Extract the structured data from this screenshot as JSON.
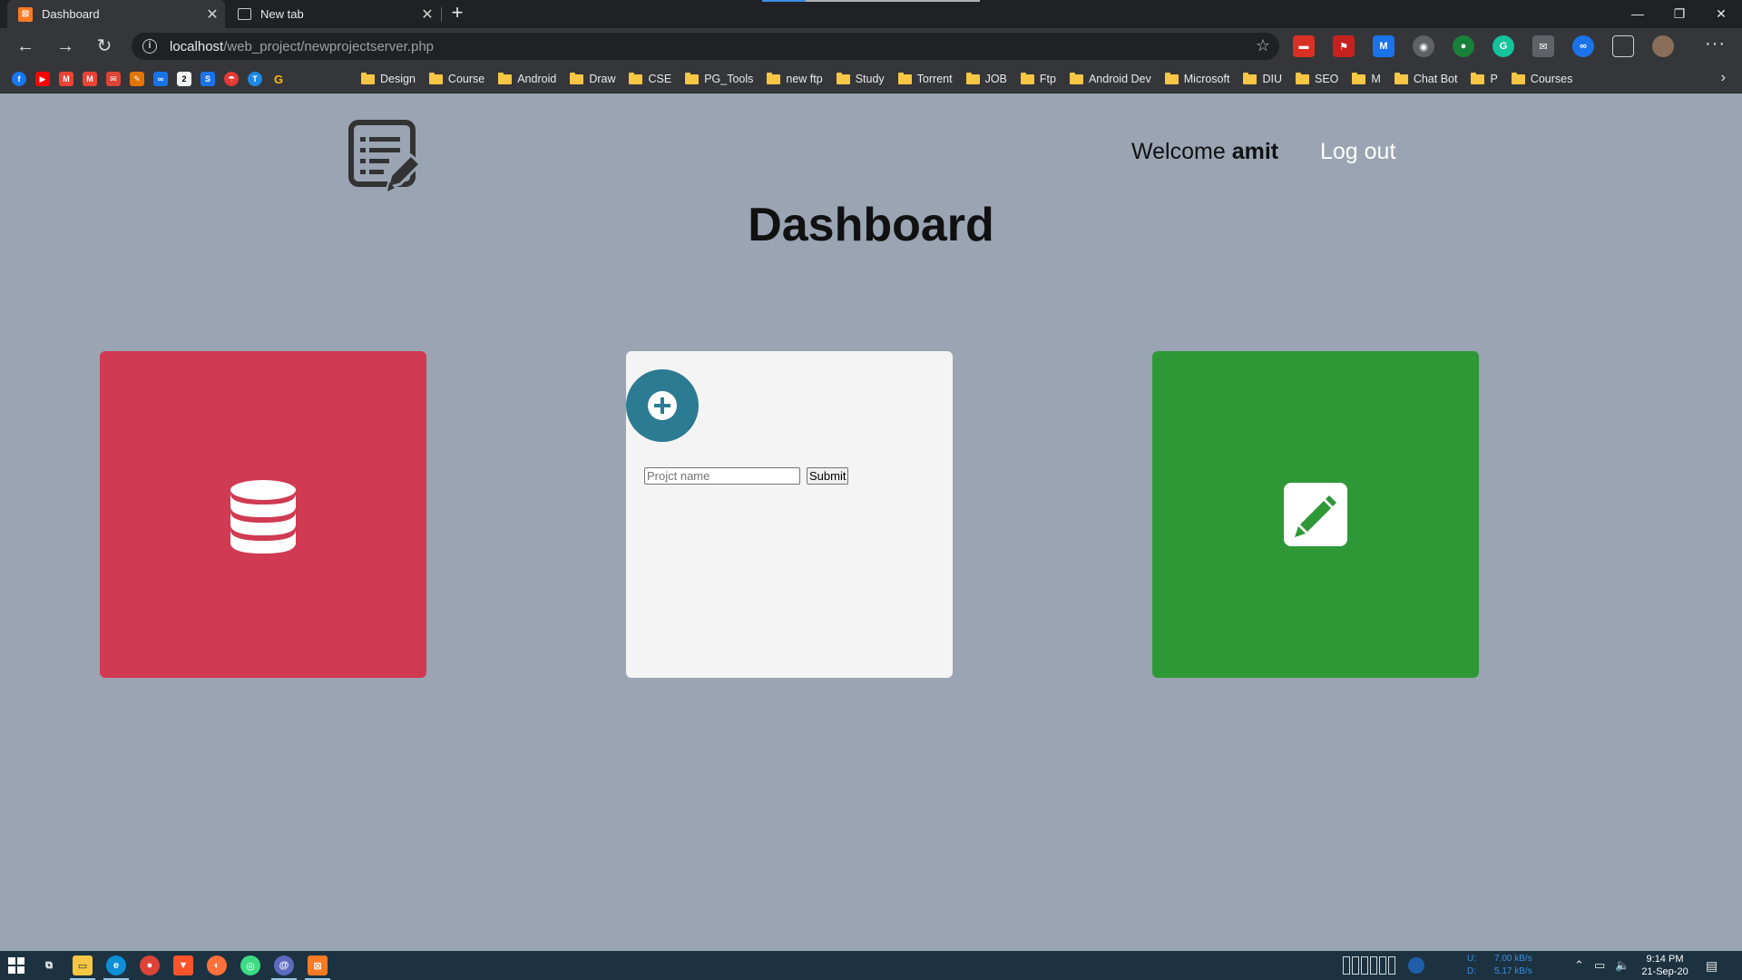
{
  "browser": {
    "tabs": [
      {
        "label": "Dashboard",
        "active": true,
        "icon": "xampp-icon"
      },
      {
        "label": "New tab",
        "active": false,
        "icon": "newtab-icon"
      }
    ],
    "url_host": "localhost",
    "url_path": "/web_project/newprojectserver.php",
    "bookmark_folders": [
      "Design",
      "Course",
      "Android",
      "Draw",
      "CSE",
      "PG_Tools",
      "new ftp",
      "Study",
      "Torrent",
      "JOB",
      "Ftp",
      "Android Dev",
      "Microsoft",
      "DIU",
      "SEO",
      "M",
      "Chat Bot",
      "P",
      "Courses"
    ]
  },
  "header": {
    "welcome_prefix": "Welcome",
    "username": "amit",
    "logout_label": "Log out"
  },
  "main": {
    "title": "Dashboard",
    "cards": [
      {
        "name": "projects",
        "icon": "database-icon",
        "color": "#d03a52"
      },
      {
        "name": "new-project",
        "icon": "plus-circle-icon",
        "color": "#f4f4f4",
        "accent": "#2b7b92"
      },
      {
        "name": "edit",
        "icon": "pencil-icon",
        "color": "#2f9836"
      }
    ],
    "form": {
      "project_name_placeholder": "Projct name",
      "project_name_value": "",
      "submit_label": "Submit"
    }
  },
  "taskbar": {
    "upload_label": "U:",
    "upload_speed": "7.00 kB/s",
    "download_label": "D:",
    "download_speed": "5.17 kB/s",
    "time": "9:14 PM",
    "date": "21-Sep-20"
  }
}
